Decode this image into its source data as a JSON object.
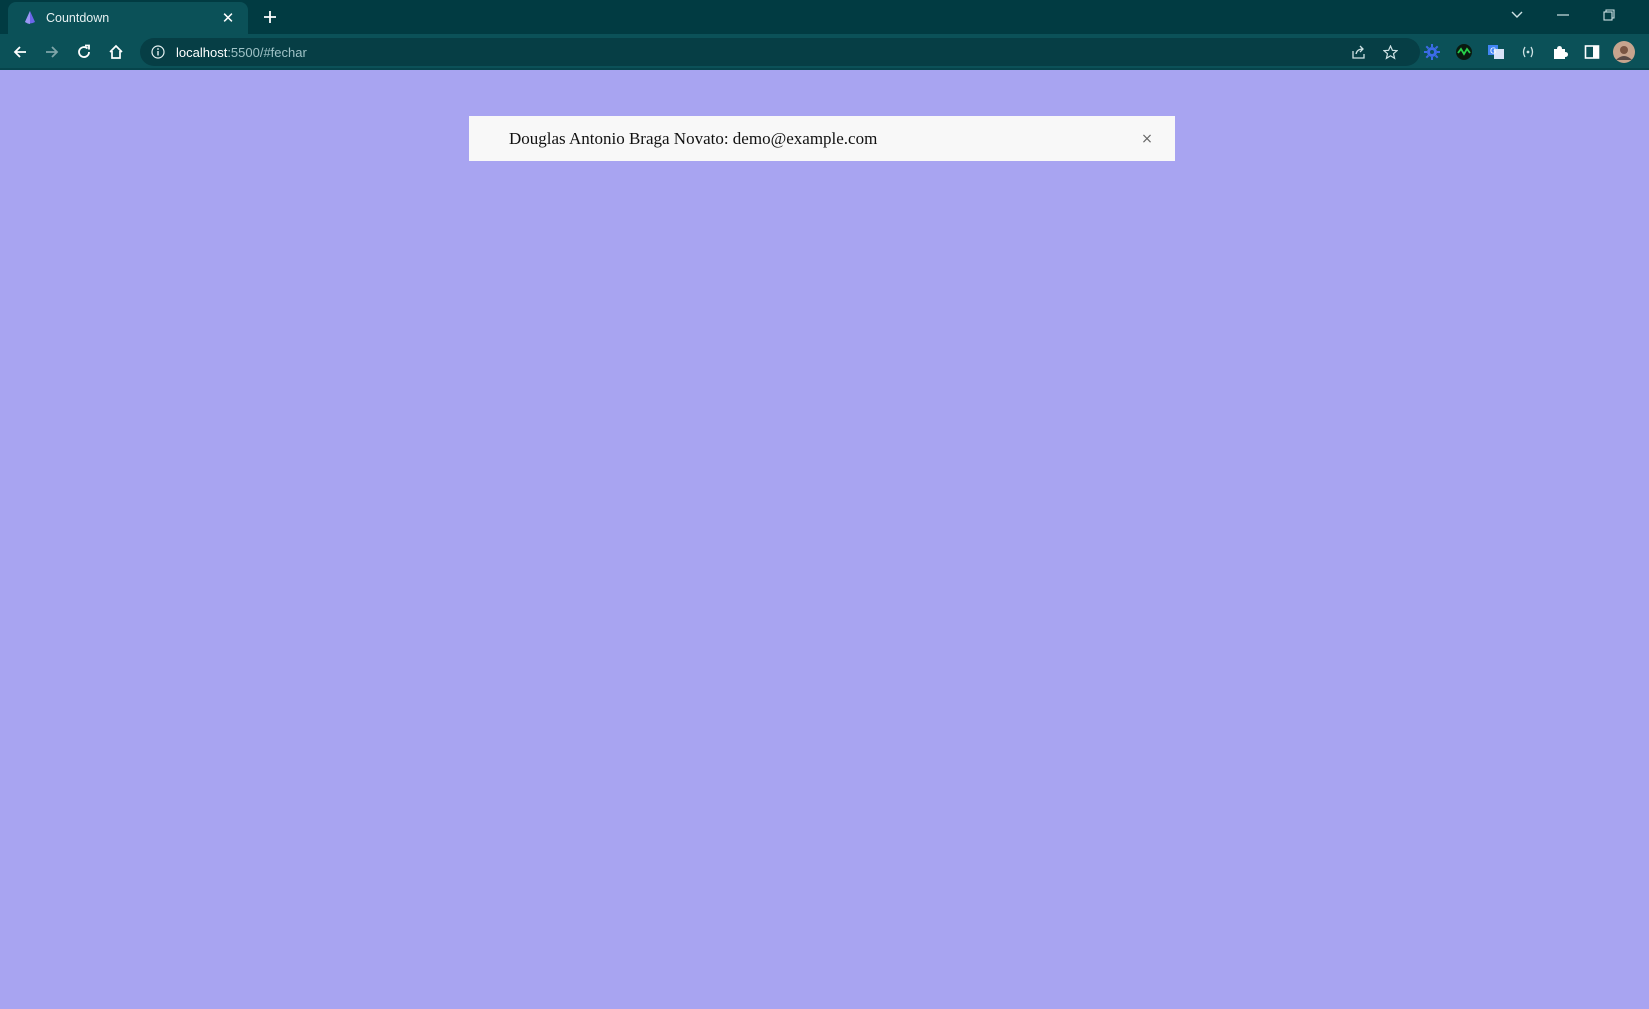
{
  "browser": {
    "tab": {
      "title": "Countdown",
      "close_glyph": "✕",
      "favicon": "droplet-icon"
    },
    "new_tab_glyph": "+",
    "address_bar": {
      "host": "localhost",
      "path": ":5500/#fechar"
    },
    "colors": {
      "tabbar": "#013b42",
      "toolbar": "#0b5158",
      "omnibox": "#063e45"
    }
  },
  "page": {
    "background": "#a8a4f1",
    "alert": {
      "text": "Douglas Antonio Braga Novato: demo@example.com",
      "close_glyph": "×"
    }
  }
}
